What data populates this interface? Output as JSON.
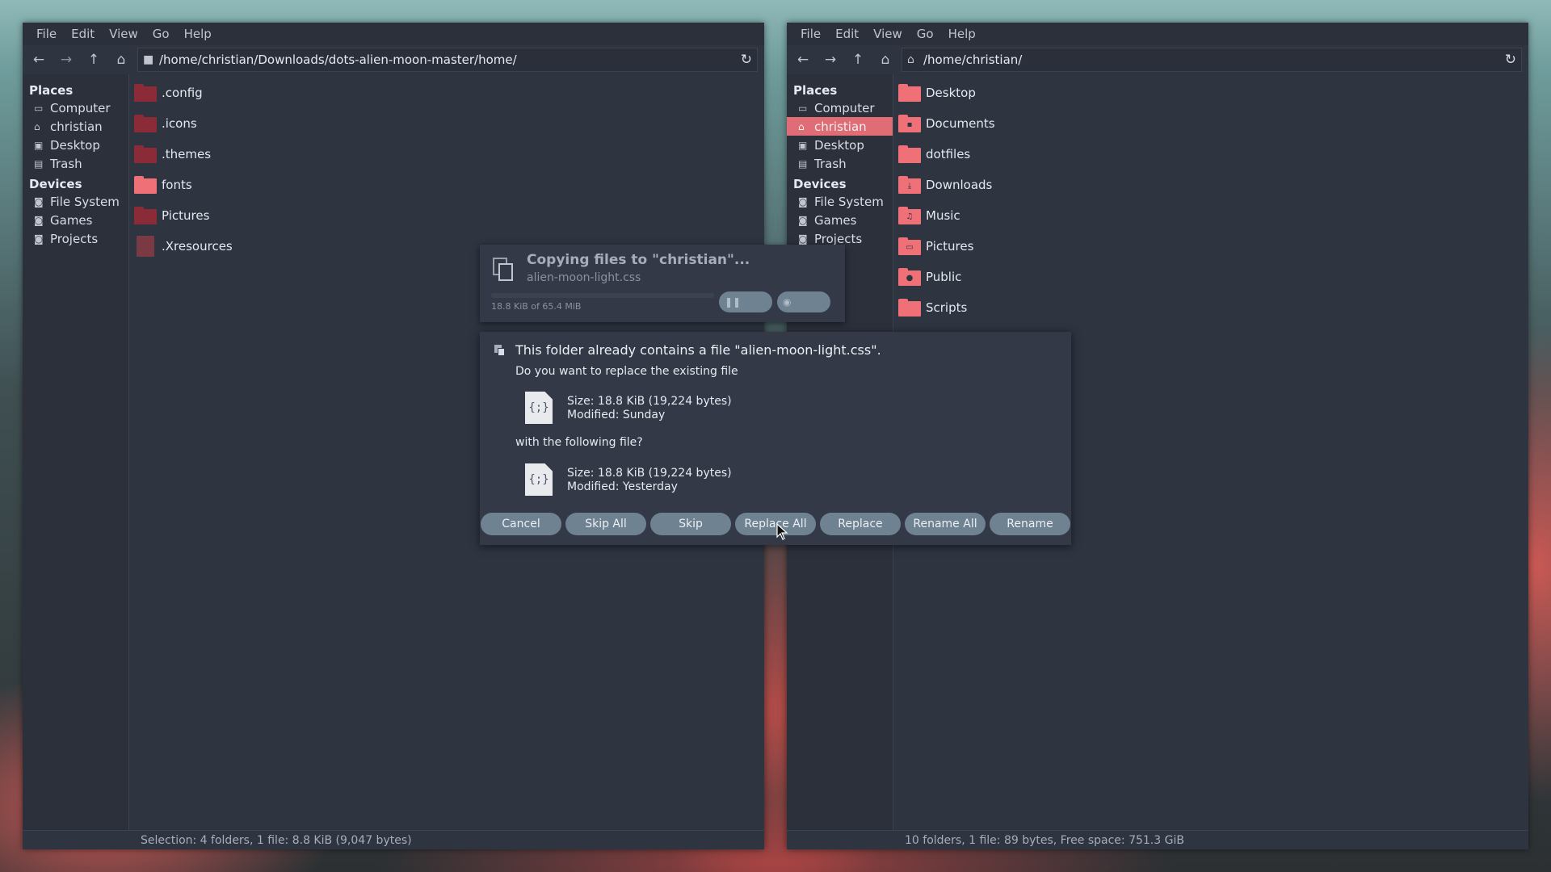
{
  "left_window": {
    "menu": [
      "File",
      "Edit",
      "View",
      "Go",
      "Help"
    ],
    "path": "/home/christian/Downloads/dots-alien-moon-master/home/",
    "sidebar": {
      "places_heading": "Places",
      "places": [
        {
          "label": "Computer",
          "icon": "computer-icon"
        },
        {
          "label": "christian",
          "icon": "home-icon"
        },
        {
          "label": "Desktop",
          "icon": "desktop-icon"
        },
        {
          "label": "Trash",
          "icon": "trash-icon"
        }
      ],
      "devices_heading": "Devices",
      "devices": [
        {
          "label": "File System",
          "icon": "drive-icon"
        },
        {
          "label": "Games",
          "icon": "drive-icon"
        },
        {
          "label": "Projects",
          "icon": "drive-icon"
        }
      ]
    },
    "files": [
      {
        "name": ".config",
        "kind": "folder-dark"
      },
      {
        "name": ".icons",
        "kind": "folder-dark"
      },
      {
        "name": ".themes",
        "kind": "folder-dark"
      },
      {
        "name": "fonts",
        "kind": "folder-pink"
      },
      {
        "name": "Pictures",
        "kind": "folder-dark"
      },
      {
        "name": ".Xresources",
        "kind": "file"
      }
    ],
    "status": "Selection: 4 folders, 1 file: 8.8 KiB (9,047 bytes)"
  },
  "right_window": {
    "menu": [
      "File",
      "Edit",
      "View",
      "Go",
      "Help"
    ],
    "path": "/home/christian/",
    "sidebar": {
      "places_heading": "Places",
      "places": [
        {
          "label": "Computer",
          "icon": "computer-icon"
        },
        {
          "label": "christian",
          "icon": "home-icon",
          "active": true
        },
        {
          "label": "Desktop",
          "icon": "desktop-icon"
        },
        {
          "label": "Trash",
          "icon": "trash-icon"
        }
      ],
      "devices_heading": "Devices",
      "devices": [
        {
          "label": "File System",
          "icon": "drive-icon"
        },
        {
          "label": "Games",
          "icon": "drive-icon"
        },
        {
          "label": "Projects",
          "icon": "drive-icon"
        }
      ]
    },
    "files": [
      {
        "name": "Desktop",
        "glyph": ""
      },
      {
        "name": "Documents",
        "glyph": "▪"
      },
      {
        "name": "dotfiles",
        "glyph": ""
      },
      {
        "name": "Downloads",
        "glyph": "⤓"
      },
      {
        "name": "Music",
        "glyph": "♫"
      },
      {
        "name": "Pictures",
        "glyph": "▭"
      },
      {
        "name": "Public",
        "glyph": "●"
      },
      {
        "name": "Scripts",
        "glyph": ""
      }
    ],
    "status": "10 folders, 1 file: 89 bytes, Free space: 751.3 GiB"
  },
  "progress_dialog": {
    "title": "Copying files to \"christian\"...",
    "file": "alien-moon-light.css",
    "size_text": "18.8 KiB of 65.4 MiB",
    "progress_fraction": 0.0
  },
  "replace_dialog": {
    "title": "This folder already contains a file \"alien-moon-light.css\".",
    "question": "Do you want to replace the existing file",
    "existing": {
      "size": "Size: 18.8 KiB (19,224 bytes)",
      "modified": "Modified: Sunday"
    },
    "with_text": "with the following file?",
    "incoming": {
      "size": "Size: 18.8 KiB (19,224 bytes)",
      "modified": "Modified: Yesterday"
    },
    "buttons": {
      "cancel": "Cancel",
      "skip_all": "Skip All",
      "skip": "Skip",
      "replace_all": "Replace All",
      "replace": "Replace",
      "rename_all": "Rename All",
      "rename": "Rename"
    }
  },
  "colors": {
    "window_bg": "#2e3440",
    "accent": "#e06c75",
    "folder_dark": "#8b2b38",
    "folder_pink": "#f07078",
    "button": "#6e8291"
  }
}
